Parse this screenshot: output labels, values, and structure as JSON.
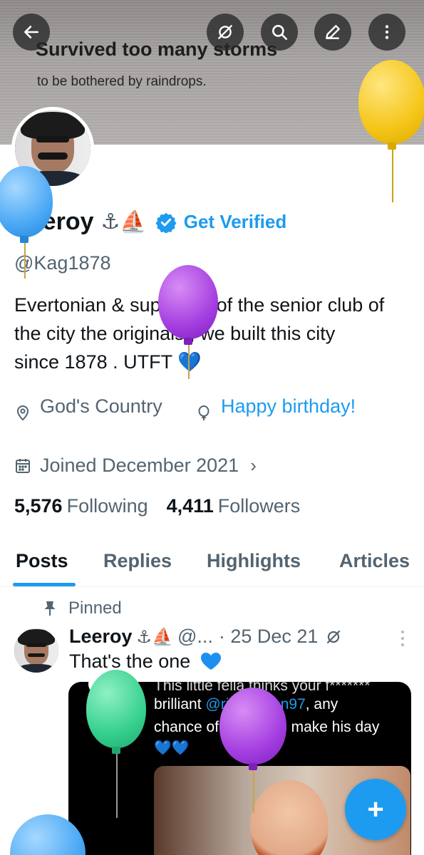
{
  "banner": {
    "line1": "Survived too many storms",
    "line2": "to be bothered by raindrops."
  },
  "header_actions": {
    "back": "arrow-left-icon",
    "grok": "grok-icon",
    "search": "search-icon",
    "edit": "edit-icon",
    "more": "more-vertical-icon"
  },
  "profile": {
    "name": "Leeroy",
    "name_emoji": "⚓⛵",
    "get_verified": "Get Verified",
    "handle": "@Kag1878",
    "bio": "Evertonian & supporter of the senior club of the city the originals , we built this city since 1878 . UTFT 💙",
    "location": "God's Country",
    "birthday": "Happy birthday!",
    "joined": "Joined December 2021",
    "following_count": "5,576",
    "following_label": "Following",
    "followers_count": "4,411",
    "followers_label": "Followers"
  },
  "tabs": [
    "Posts",
    "Replies",
    "Highlights",
    "Articles"
  ],
  "post": {
    "pinned_label": "Pinned",
    "author": "Leeroy",
    "author_emoji": "⚓⛵",
    "handle": "@...",
    "date": "· 25 Dec 21",
    "text": "That's the one",
    "media_text": {
      "line1": "This little fella thinks your f*******",
      "line2_a": "brilliant ",
      "line2_tag": "@richarlison97",
      "line2_b": ", any",
      "line3": "chance of a wave to make his day",
      "line4": "💙💙"
    }
  },
  "fab_label": "+",
  "colors": {
    "accent": "#1d9bf0",
    "text_primary": "#0f1419",
    "text_secondary": "#536471"
  }
}
